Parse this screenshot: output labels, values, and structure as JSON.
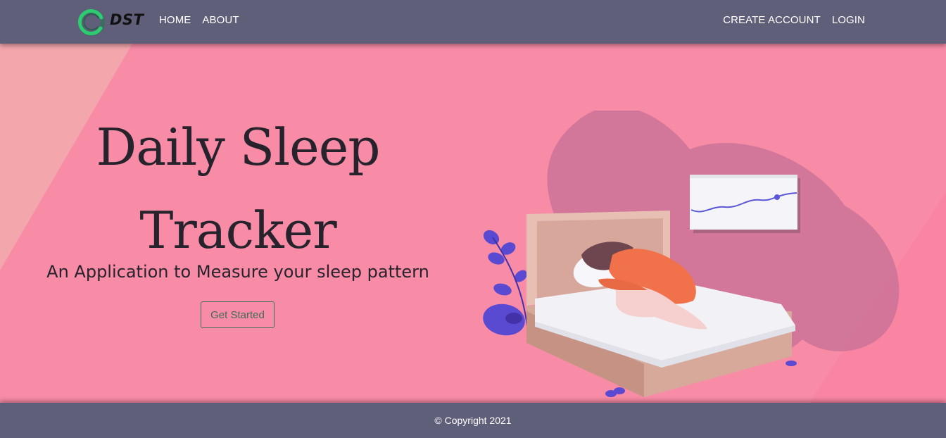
{
  "navbar": {
    "brand": "DST",
    "left_links": [
      "HOME",
      "ABOUT"
    ],
    "right_links": [
      "CREATE ACCOUNT",
      "LOGIN"
    ]
  },
  "hero": {
    "title_line1": "Daily Sleep",
    "title_line2": "Tracker",
    "subtitle": "An Application to Measure your sleep pattern",
    "cta_label": "Get Started",
    "illustration": "sleeping-woman-bed-illustration"
  },
  "footer": {
    "copyright": "© Copyright 2021"
  },
  "colors": {
    "navbar": "#5f5f7a",
    "hero_background": "#f88ba6",
    "text_dark": "#27232d",
    "cta_border": "#3f6b58",
    "logo_accent": "#2ecc71"
  }
}
